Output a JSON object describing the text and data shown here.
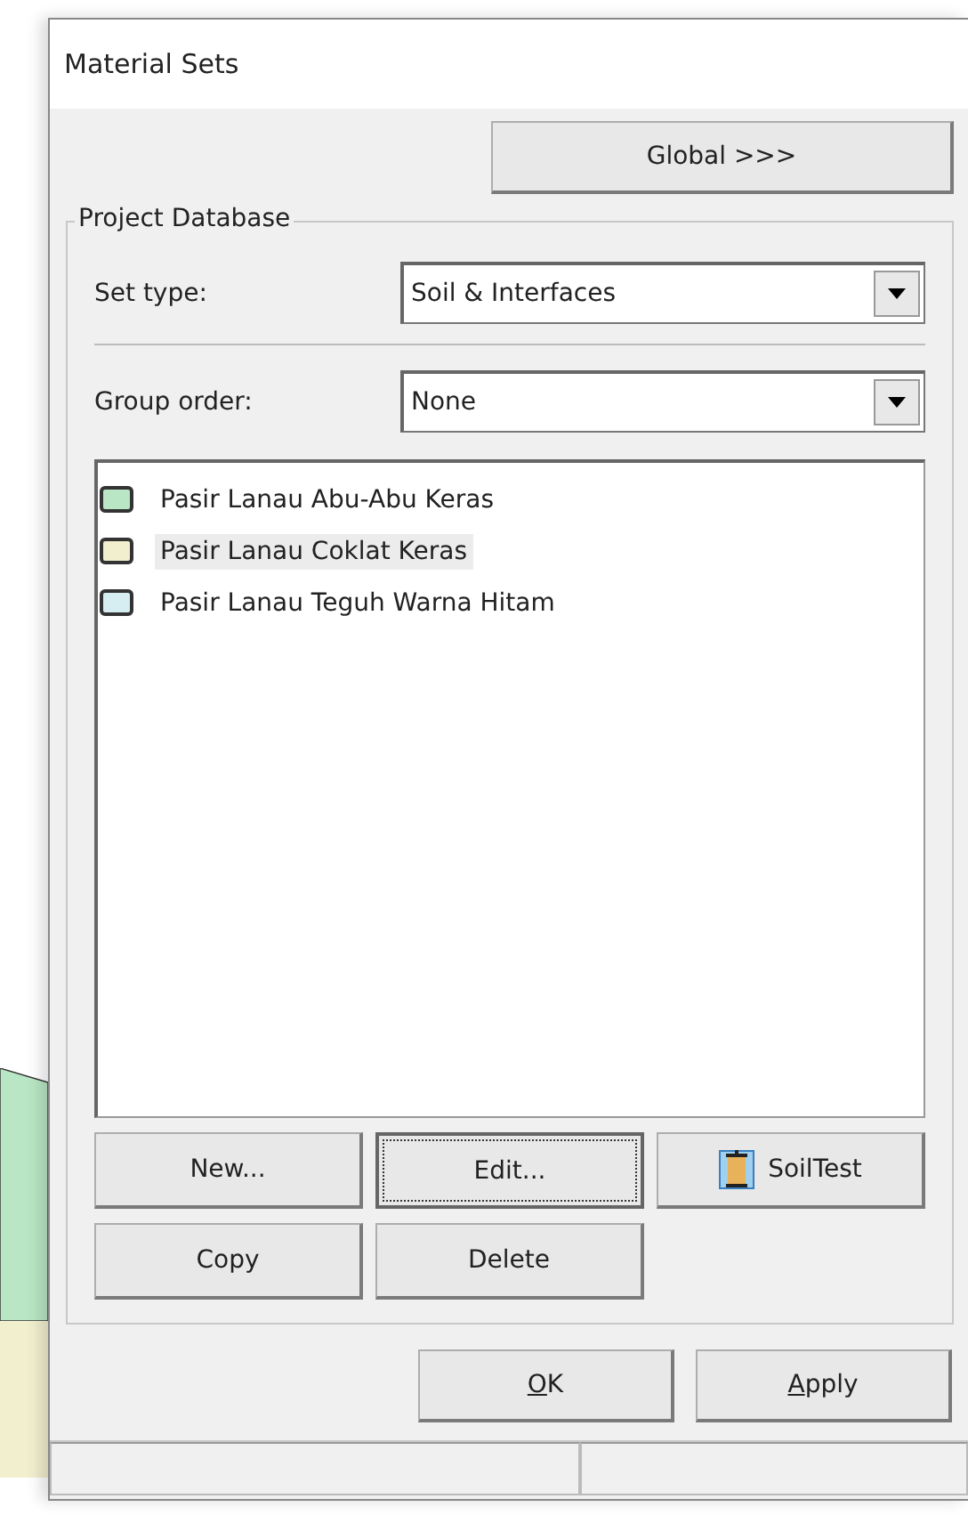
{
  "window": {
    "title": "Material Sets"
  },
  "global_button": {
    "label": "Global >>>"
  },
  "group": {
    "title": "Project Database",
    "set_type": {
      "label": "Set type:",
      "value": "Soil & Interfaces"
    },
    "group_order": {
      "label": "Group order:",
      "value": "None"
    },
    "materials": [
      {
        "name": "Pasir Lanau Abu-Abu Keras",
        "color": "#b9e6c4",
        "selected": false
      },
      {
        "name": "Pasir Lanau Coklat Keras",
        "color": "#f2efcf",
        "selected": true
      },
      {
        "name": "Pasir Lanau Teguh Warna Hitam",
        "color": "#d6eef2",
        "selected": false
      }
    ],
    "buttons": [
      {
        "label": "New...",
        "kind": "plain",
        "focused": false
      },
      {
        "label": "Edit...",
        "kind": "plain",
        "focused": true
      },
      {
        "label": "SoilTest",
        "kind": "icon",
        "focused": false
      },
      {
        "label": "Copy",
        "kind": "plain",
        "focused": false
      },
      {
        "label": "Delete",
        "kind": "plain",
        "focused": false
      }
    ]
  },
  "dialog_buttons": [
    {
      "accel": "O",
      "rest": "K"
    },
    {
      "accel": "A",
      "rest": "pply"
    }
  ]
}
